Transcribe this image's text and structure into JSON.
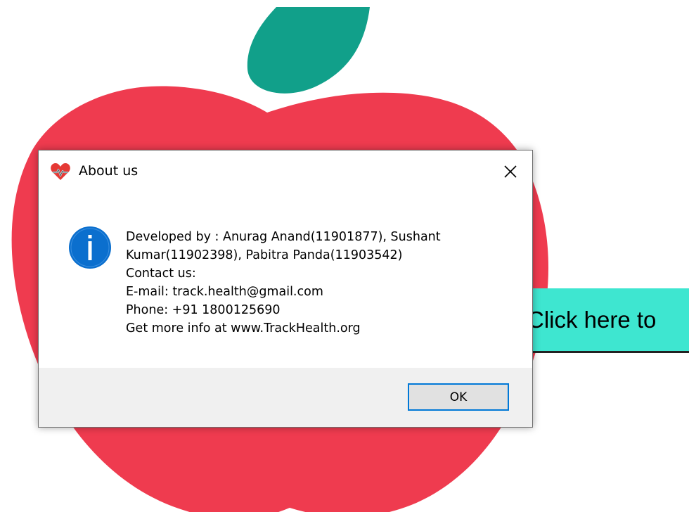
{
  "dialog": {
    "title": "About us",
    "close_icon": "close-icon",
    "app_icon": "heart-pulse-icon",
    "status_icon": "info-icon",
    "message_lines": [
      "Developed by : Anurag Anand(11901877), Sushant",
      "Kumar(11902398), Pabitra Panda(11903542)",
      "Contact us:",
      "E-mail: track.health@gmail.com",
      "Phone: +91 1800125690",
      "Get more info at www.TrackHealth.org"
    ],
    "ok_label": "OK"
  },
  "background": {
    "cta_label": "Click here to",
    "apple_color": "#ef3b4f",
    "leaf_color": "#11a08a",
    "cta_color": "#3ee6d0"
  },
  "colors": {
    "info_blue": "#0b6fce",
    "focus_border": "#0078d7",
    "footer_bg": "#f0f0f0"
  }
}
